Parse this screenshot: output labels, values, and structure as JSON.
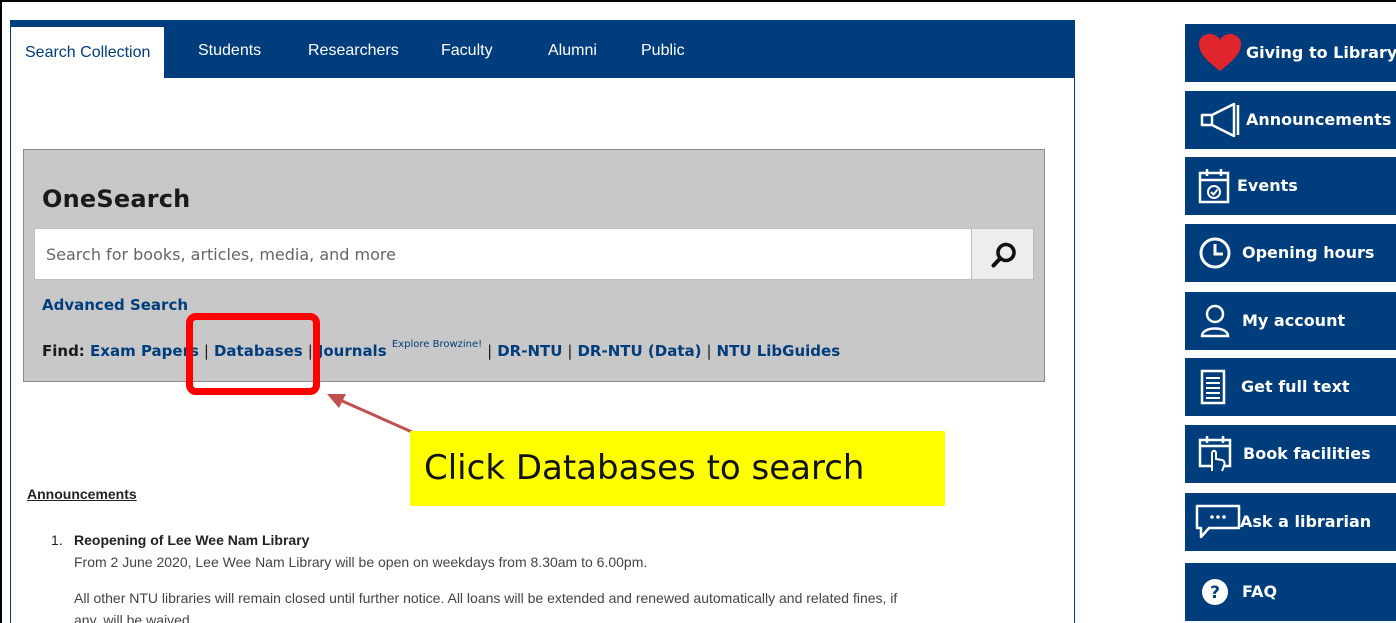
{
  "tabs": [
    {
      "label": "Search Collection",
      "active": true
    },
    {
      "label": "Students"
    },
    {
      "label": "Researchers"
    },
    {
      "label": "Faculty"
    },
    {
      "label": "Alumni"
    },
    {
      "label": "Public"
    }
  ],
  "onesearch": {
    "title": "OneSearch",
    "placeholder": "Search for books, articles, media, and more",
    "advanced_label": "Advanced Search",
    "find_label": "Find:",
    "links": {
      "exam_papers": "Exam Papers",
      "databases": "Databases",
      "journals": "Journals",
      "browzine": "Explore Browzine!",
      "dr_ntu": "DR-NTU",
      "dr_ntu_data": "DR-NTU (Data)",
      "libguides": "NTU LibGuides"
    },
    "separator": "|"
  },
  "annotation": {
    "label": "Click Databases to search",
    "box_color": "#ff0000",
    "label_bg": "#ffff00",
    "arrow_color": "#c0504d"
  },
  "announcements": {
    "title": "Announcements",
    "item_number": "1.",
    "item_title": "Reopening of Lee Wee Nam Library",
    "line1": "From 2 June 2020, Lee Wee Nam Library will be open on weekdays from 8.30am to 6.00pm.",
    "line2": "All other NTU libraries will remain closed until further notice. All loans will be extended and renewed automatically and related fines, if",
    "line3": "any, will be waived."
  },
  "sidebar": [
    {
      "label": "Giving to Library",
      "icon": "heart-icon"
    },
    {
      "label": "Announcements",
      "icon": "megaphone-icon"
    },
    {
      "label": "Events",
      "icon": "calendar-icon"
    },
    {
      "label": "Opening hours",
      "icon": "clock-icon"
    },
    {
      "label": "My account",
      "icon": "user-icon"
    },
    {
      "label": "Get full text",
      "icon": "document-icon"
    },
    {
      "label": "Book facilities",
      "icon": "booking-calendar-icon"
    },
    {
      "label": "Ask a librarian",
      "icon": "chat-icon"
    },
    {
      "label": "FAQ",
      "icon": "question-icon"
    }
  ],
  "colors": {
    "brand_navy": "#003d7c",
    "search_box_gray": "#c8c8c8",
    "heart_red": "#e0262c"
  }
}
